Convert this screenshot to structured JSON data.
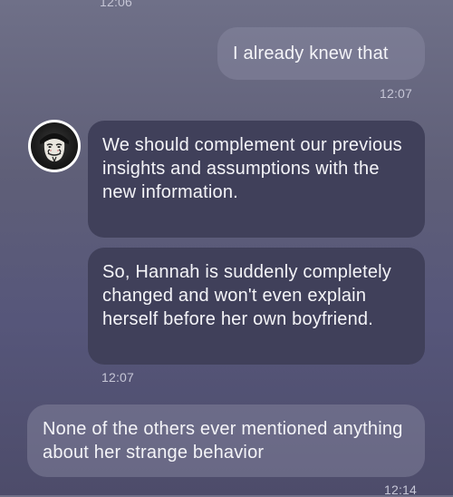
{
  "messages": [
    {
      "type": "timestamp",
      "text": "12:06"
    },
    {
      "type": "outgoing",
      "text": "I already knew that"
    },
    {
      "type": "timestamp",
      "text": "12:07"
    },
    {
      "type": "incoming",
      "text": "We should complement our previous insights and assumptions with the new information."
    },
    {
      "type": "incoming",
      "text": "So, Hannah is suddenly completely changed and won't even explain herself before her own boyfriend."
    },
    {
      "type": "timestamp",
      "text": "12:07"
    },
    {
      "type": "outgoing",
      "text": "None of the others ever mentioned anything about her strange behavior"
    },
    {
      "type": "timestamp",
      "text": "12:14"
    }
  ],
  "contact": {
    "avatar_icon": "guy-fawkes-mask-icon"
  }
}
